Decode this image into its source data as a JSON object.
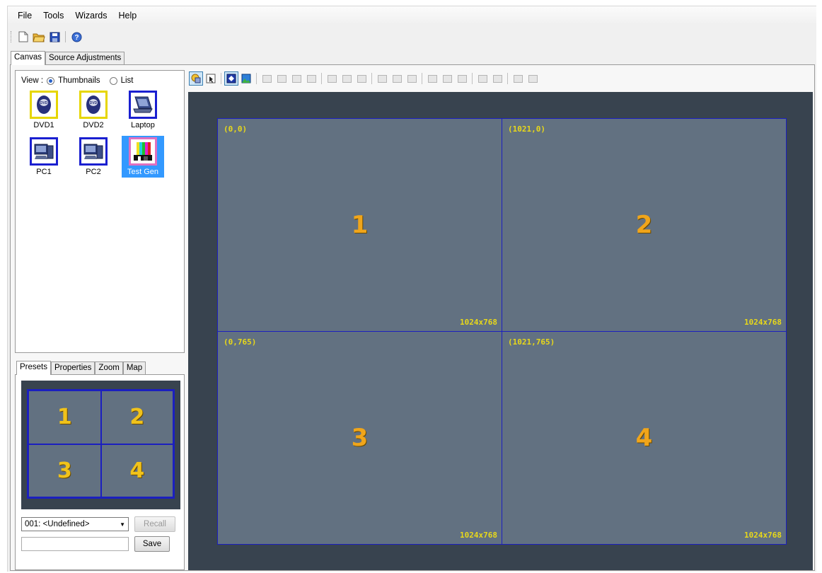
{
  "menu": [
    "File",
    "Tools",
    "Wizards",
    "Help"
  ],
  "toolbar_icons": [
    "new-file-icon",
    "open-folder-icon",
    "save-icon",
    "help-icon"
  ],
  "top_tabs": [
    "Canvas",
    "Source Adjustments"
  ],
  "sources": {
    "view_label": "View :",
    "view_options": [
      "Thumbnails",
      "List"
    ],
    "selected_view": "Thumbnails",
    "items": [
      {
        "label": "DVD1",
        "icon": "dvd-icon",
        "border": "#e6d600"
      },
      {
        "label": "DVD2",
        "icon": "dvd-icon",
        "border": "#e6d600"
      },
      {
        "label": "Laptop",
        "icon": "laptop-icon",
        "border": "#1a1fd0"
      },
      {
        "label": "PC1",
        "icon": "pc-icon",
        "border": "#1a1fd0"
      },
      {
        "label": "PC2",
        "icon": "pc-icon",
        "border": "#1a1fd0"
      },
      {
        "label": "Test Gen",
        "icon": "test-pattern-icon",
        "border": "#e070c0",
        "selected": true
      }
    ]
  },
  "lower_tabs": [
    "Presets",
    "Properties",
    "Zoom",
    "Map"
  ],
  "presets": {
    "cells": [
      "1",
      "2",
      "3",
      "4"
    ],
    "selected_preset": "001: <Undefined>",
    "recall_label": "Recall",
    "save_label": "Save",
    "name_value": ""
  },
  "canvas": {
    "displays": [
      {
        "number": "1",
        "origin": "(0,0)",
        "resolution": "1024x768"
      },
      {
        "number": "2",
        "origin": "(1021,0)",
        "resolution": "1024x768"
      },
      {
        "number": "3",
        "origin": "(0,765)",
        "resolution": "1024x768"
      },
      {
        "number": "4",
        "origin": "(1021,765)",
        "resolution": "1024x768"
      }
    ]
  },
  "colors": {
    "canvas_bg": "#38434f",
    "display_bg": "#627181",
    "display_border": "#1b1fbf",
    "label_yellow": "#e8d81a",
    "number_orange": "#f0a51a",
    "selection_blue": "#3399ff"
  }
}
